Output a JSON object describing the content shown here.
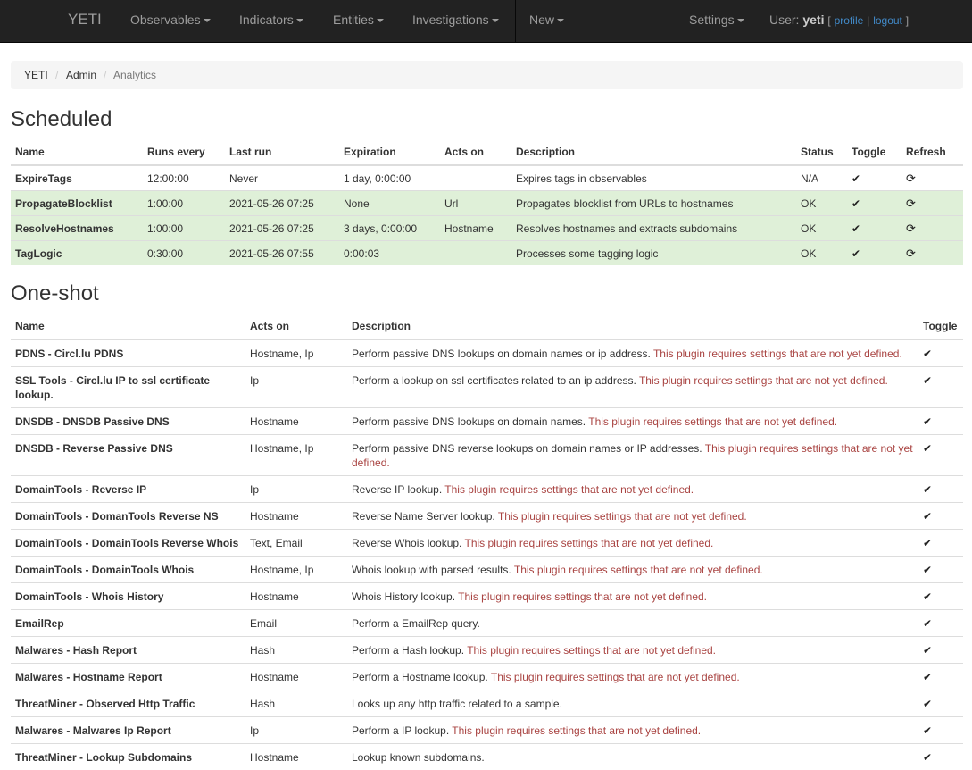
{
  "navbar": {
    "brand": "YETI",
    "menus": [
      "Observables",
      "Indicators",
      "Entities",
      "Investigations",
      "New"
    ],
    "settings": "Settings",
    "user_prefix": "User:",
    "username": "yeti",
    "profile": "profile",
    "logout": "logout"
  },
  "breadcrumb": [
    "YETI",
    "Admin",
    "Analytics"
  ],
  "scheduled": {
    "title": "Scheduled",
    "headers": [
      "Name",
      "Runs every",
      "Last run",
      "Expiration",
      "Acts on",
      "Description",
      "Status",
      "Toggle",
      "Refresh"
    ],
    "rows": [
      {
        "name": "ExpireTags",
        "runs": "12:00:00",
        "last": "Never",
        "exp": "1 day, 0:00:00",
        "acts": "",
        "desc": "Expires tags in observables",
        "status": "N/A",
        "ok": false
      },
      {
        "name": "PropagateBlocklist",
        "runs": "1:00:00",
        "last": "2021-05-26 07:25",
        "exp": "None",
        "acts": "Url",
        "desc": "Propagates blocklist from URLs to hostnames",
        "status": "OK",
        "ok": true
      },
      {
        "name": "ResolveHostnames",
        "runs": "1:00:00",
        "last": "2021-05-26 07:25",
        "exp": "3 days, 0:00:00",
        "acts": "Hostname",
        "desc": "Resolves hostnames and extracts subdomains",
        "status": "OK",
        "ok": true
      },
      {
        "name": "TagLogic",
        "runs": "0:30:00",
        "last": "2021-05-26 07:55",
        "exp": "0:00:03",
        "acts": "",
        "desc": "Processes some tagging logic",
        "status": "OK",
        "ok": true
      }
    ]
  },
  "oneshot": {
    "title": "One-shot",
    "headers": [
      "Name",
      "Acts on",
      "Description",
      "Toggle"
    ],
    "warning": "This plugin requires settings that are not yet defined.",
    "rows": [
      {
        "name": "PDNS - Circl.lu PDNS",
        "acts": "Hostname, Ip",
        "desc": "Perform passive DNS lookups on domain names or ip address.",
        "warn": true
      },
      {
        "name": "SSL Tools - Circl.lu IP to ssl certificate lookup.",
        "acts": "Ip",
        "desc": "Perform a lookup on ssl certificates related to an ip address.",
        "warn": true
      },
      {
        "name": "DNSDB - DNSDB Passive DNS",
        "acts": "Hostname",
        "desc": "Perform passive DNS lookups on domain names.",
        "warn": true
      },
      {
        "name": "DNSDB - Reverse Passive DNS",
        "acts": "Hostname, Ip",
        "desc": "Perform passive DNS reverse lookups on domain names or IP addresses.",
        "warn": true
      },
      {
        "name": "DomainTools - Reverse IP",
        "acts": "Ip",
        "desc": "Reverse IP lookup.",
        "warn": true
      },
      {
        "name": "DomainTools - DomanTools Reverse NS",
        "acts": "Hostname",
        "desc": "Reverse Name Server lookup.",
        "warn": true
      },
      {
        "name": "DomainTools - DomainTools Reverse Whois",
        "acts": "Text, Email",
        "desc": "Reverse Whois lookup.",
        "warn": true
      },
      {
        "name": "DomainTools - DomainTools Whois",
        "acts": "Hostname, Ip",
        "desc": "Whois lookup with parsed results.",
        "warn": true
      },
      {
        "name": "DomainTools - Whois History",
        "acts": "Hostname",
        "desc": "Whois History lookup.",
        "warn": true
      },
      {
        "name": "EmailRep",
        "acts": "Email",
        "desc": "Perform a EmailRep query.",
        "warn": false
      },
      {
        "name": "Malwares - Hash Report",
        "acts": "Hash",
        "desc": "Perform a Hash lookup.",
        "warn": true
      },
      {
        "name": "Malwares - Hostname Report",
        "acts": "Hostname",
        "desc": "Perform a Hostname lookup.",
        "warn": true
      },
      {
        "name": "ThreatMiner - Observed Http Traffic",
        "acts": "Hash",
        "desc": "Looks up any http traffic related to a sample.",
        "warn": false
      },
      {
        "name": "Malwares - Malwares Ip Report",
        "acts": "Ip",
        "desc": "Perform a IP lookup.",
        "warn": true
      },
      {
        "name": "ThreatMiner - Lookup Subdomains",
        "acts": "Hostname",
        "desc": "Lookup known subdomains.",
        "warn": false
      }
    ]
  },
  "icons": {
    "toggle": "check-icon",
    "refresh": "refresh-icon"
  }
}
